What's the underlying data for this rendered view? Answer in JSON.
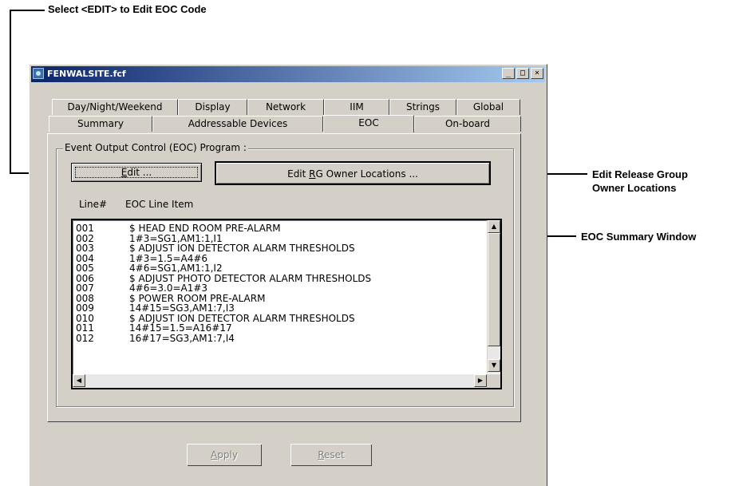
{
  "callouts": {
    "top": "Select <EDIT> to Edit EOC Code",
    "right1_line1": "Edit Release Group",
    "right1_line2": "Owner Locations",
    "right2": "EOC Summary Window"
  },
  "window": {
    "title": "FENWALSITE.fcf",
    "controls": {
      "minimize": "_",
      "maximize": "□",
      "close": "×"
    }
  },
  "tabs": {
    "row_back": [
      "Day/Night/Weekend",
      "Display",
      "Network",
      "IIM",
      "Strings",
      "Global"
    ],
    "row_front": [
      "Summary",
      "Addressable Devices",
      "EOC",
      "On-board"
    ],
    "active": "EOC"
  },
  "eoc": {
    "group_label": "Event Output Control (EOC) Program :",
    "edit_button": {
      "mnemonic": "E",
      "rest": "dit ..."
    },
    "edit_rg_button": {
      "before": "Edit ",
      "mnemonic": "R",
      "after": "G Owner Locations ..."
    },
    "columns": {
      "line": "Line#",
      "item": "EOC Line Item"
    },
    "rows": [
      {
        "num": "001",
        "text": "$ HEAD END ROOM PRE-ALARM"
      },
      {
        "num": "002",
        "text": "1#3=SG1,AM1:1,I1"
      },
      {
        "num": "003",
        "text": "$ ADJUST ION DETECTOR ALARM THRESHOLDS"
      },
      {
        "num": "004",
        "text": "1#3=1.5=A4#6"
      },
      {
        "num": "005",
        "text": "4#6=SG1,AM1:1,I2"
      },
      {
        "num": "006",
        "text": "$ ADJUST PHOTO DETECTOR ALARM THRESHOLDS"
      },
      {
        "num": "007",
        "text": "4#6=3.0=A1#3"
      },
      {
        "num": "008",
        "text": "$ POWER ROOM PRE-ALARM"
      },
      {
        "num": "009",
        "text": "14#15=SG3,AM1:7,I3"
      },
      {
        "num": "010",
        "text": "$ ADJUST ION DETECTOR ALARM THRESHOLDS"
      },
      {
        "num": "011",
        "text": "14#15=1.5=A16#17"
      },
      {
        "num": "012",
        "text": "16#17=SG3,AM1:7,I4"
      }
    ]
  },
  "footer": {
    "apply": {
      "mnemonic": "A",
      "rest": "pply"
    },
    "reset": {
      "mnemonic": "R",
      "rest": "eset"
    }
  },
  "icons": {
    "scroll_up": "triangle-up",
    "scroll_down": "triangle-down",
    "scroll_left": "triangle-left",
    "scroll_right": "triangle-right"
  }
}
